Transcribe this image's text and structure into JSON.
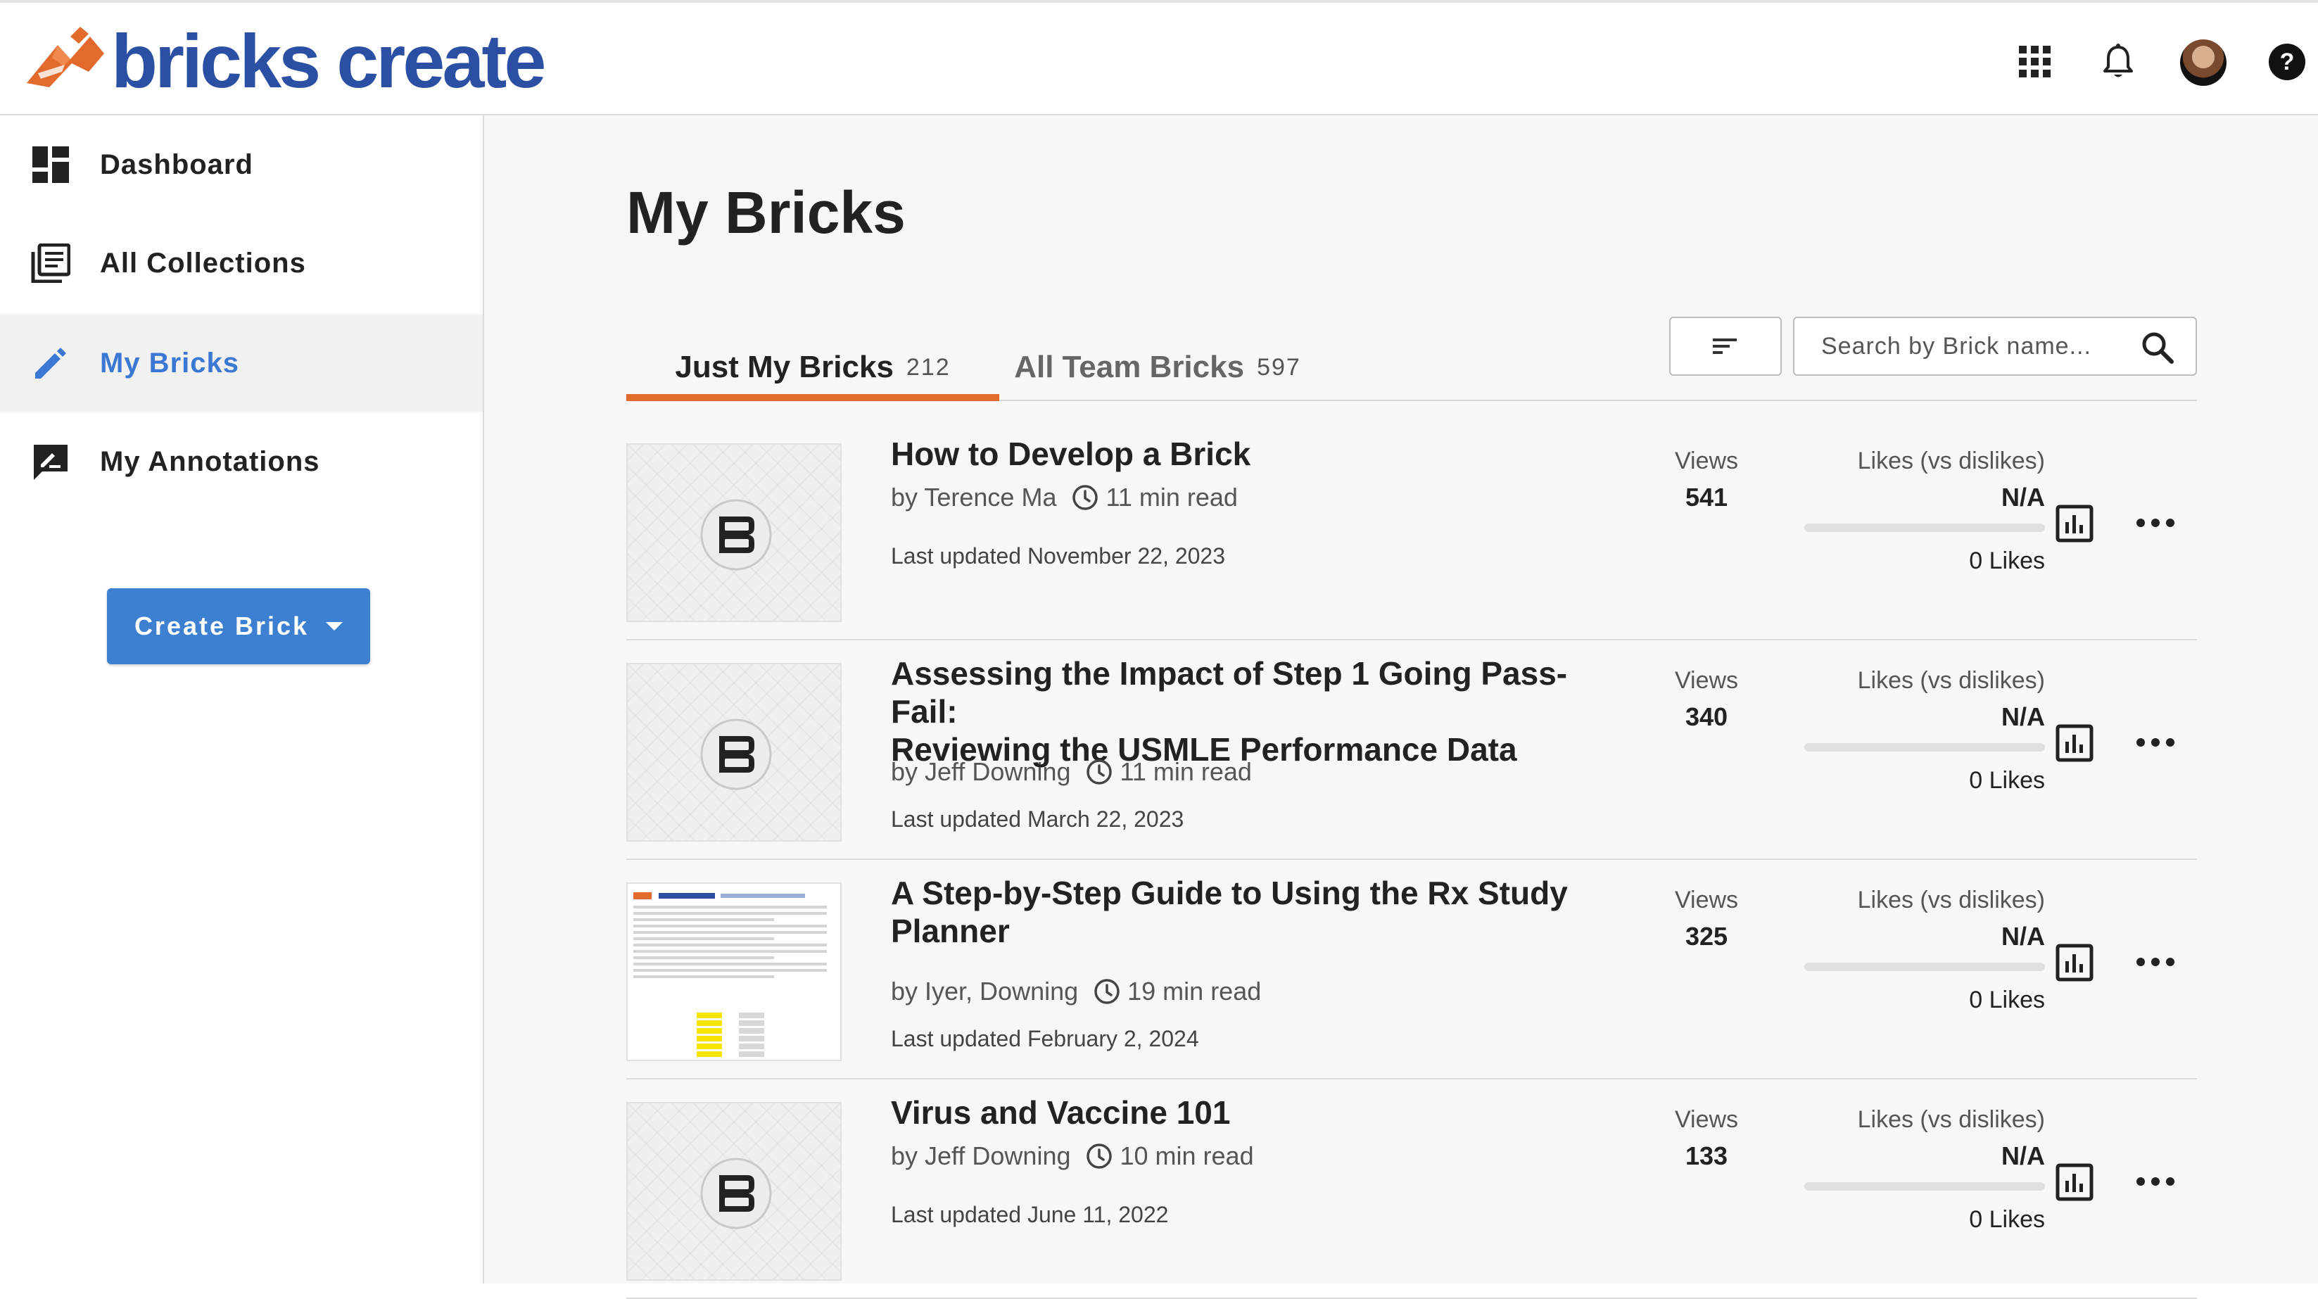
{
  "header": {
    "logo_text": "bricks create",
    "icons": [
      "apps-grid-icon",
      "bell-icon",
      "user-avatar",
      "help-icon"
    ]
  },
  "sidebar": {
    "items": [
      {
        "label": "Dashboard",
        "icon": "dashboard-icon",
        "active": false
      },
      {
        "label": "All Collections",
        "icon": "collections-icon",
        "active": false
      },
      {
        "label": "My Bricks",
        "icon": "pencil-icon",
        "active": true
      },
      {
        "label": "My Annotations",
        "icon": "annotation-icon",
        "active": false
      }
    ],
    "create_button": "Create Brick"
  },
  "main": {
    "title": "My Bricks",
    "tabs": [
      {
        "label": "Just My Bricks",
        "count": "212",
        "active": true
      },
      {
        "label": "All Team Bricks",
        "count": "597",
        "active": false
      }
    ],
    "search": {
      "placeholder": "Search by Brick name...",
      "value": ""
    },
    "stats_labels": {
      "views": "Views",
      "likes": "Likes (vs dislikes)"
    },
    "bricks": [
      {
        "title_lines": [
          "How to Develop a Brick"
        ],
        "author": "by Terence Ma",
        "read_time": "11 min read",
        "updated": "Last updated November 22, 2023",
        "views": "541",
        "likes_ratio": "N/A",
        "likes_ratio_fraction": 0,
        "likes": "0 Likes",
        "thumbnail": "brick-logo"
      },
      {
        "title_lines": [
          "Assessing the Impact of Step 1 Going Pass-Fail:",
          "Reviewing the USMLE Performance Data"
        ],
        "author": "by Jeff Downing",
        "read_time": "11 min read",
        "updated": "Last updated March 22, 2023",
        "views": "340",
        "likes_ratio": "N/A",
        "likes_ratio_fraction": 0,
        "likes": "0 Likes",
        "thumbnail": "brick-logo"
      },
      {
        "title_lines": [
          "A Step-by-Step Guide to Using the Rx Study",
          "Planner"
        ],
        "author": "by Iyer, Downing",
        "read_time": "19 min read",
        "updated": "Last updated February 2, 2024",
        "views": "325",
        "likes_ratio": "N/A",
        "likes_ratio_fraction": 0,
        "likes": "0 Likes",
        "thumbnail": "document-preview"
      },
      {
        "title_lines": [
          "Virus and Vaccine 101"
        ],
        "author": "by Jeff Downing",
        "read_time": "10 min read",
        "updated": "Last updated June 11, 2022",
        "views": "133",
        "likes_ratio": "N/A",
        "likes_ratio_fraction": 0,
        "likes": "0 Likes",
        "thumbnail": "brick-logo"
      }
    ]
  },
  "colors": {
    "accent_blue": "#3d7fd1",
    "tab_underline": "#e26a2c",
    "logo_blue": "#2b4fa3",
    "logo_orange": "#e26a2c"
  }
}
